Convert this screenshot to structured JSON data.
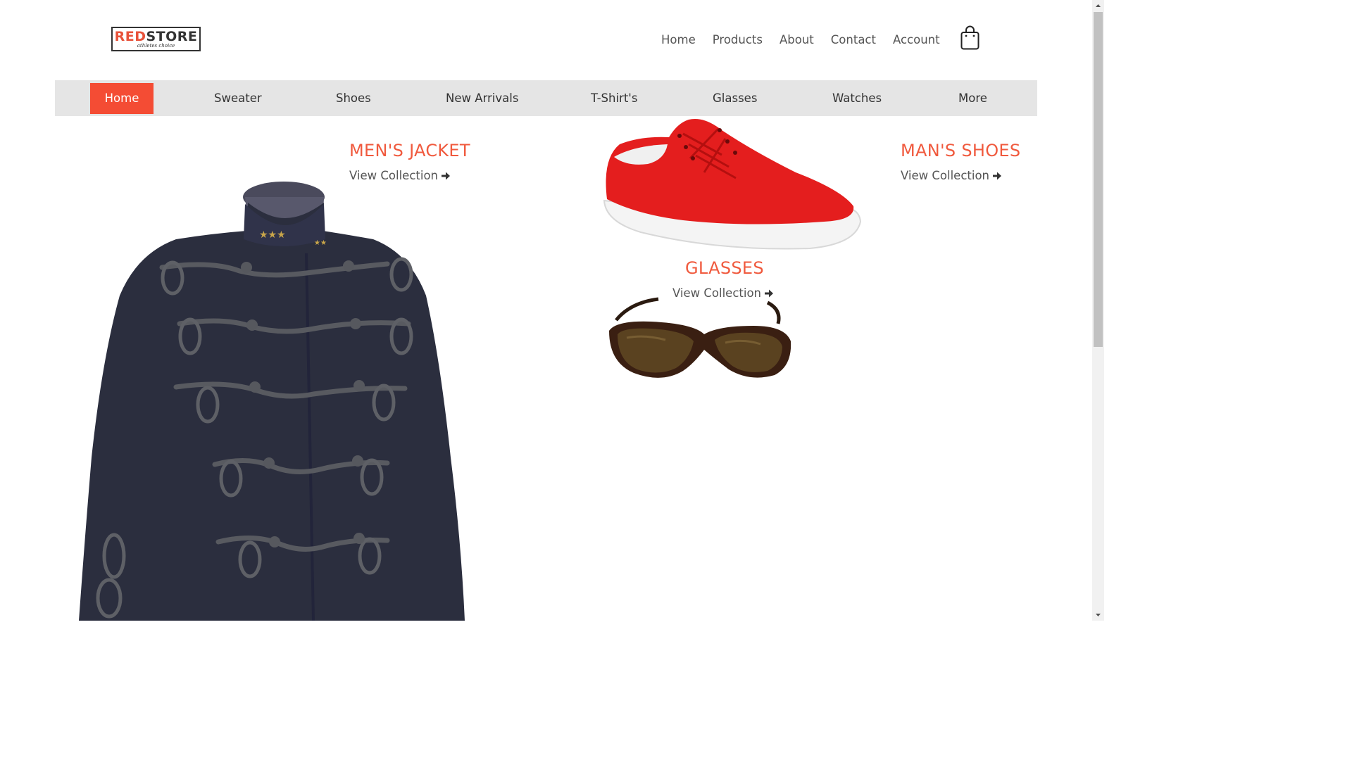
{
  "brand": {
    "name_red": "RED",
    "name_dark": "STORE",
    "tagline": "athletes choice",
    "accent_color": "#f44c34"
  },
  "top_nav": {
    "items": [
      "Home",
      "Products",
      "About",
      "Contact",
      "Account"
    ],
    "cart_icon": "shopping-bag-icon"
  },
  "category_bar": {
    "items": [
      "Home",
      "Sweater",
      "Shoes",
      "New Arrivals",
      "T-Shirt's",
      "Glasses",
      "Watches",
      "More"
    ],
    "active": "Home"
  },
  "promos": {
    "jacket": {
      "title": "MEN'S JACKET",
      "link": "View Collection"
    },
    "shoes": {
      "title": "MAN'S SHOES",
      "link": "View Collection"
    },
    "glasses": {
      "title": "GLASSES",
      "link": "View Collection"
    }
  },
  "icons": {
    "link_arrow": "arrow-right-icon"
  }
}
